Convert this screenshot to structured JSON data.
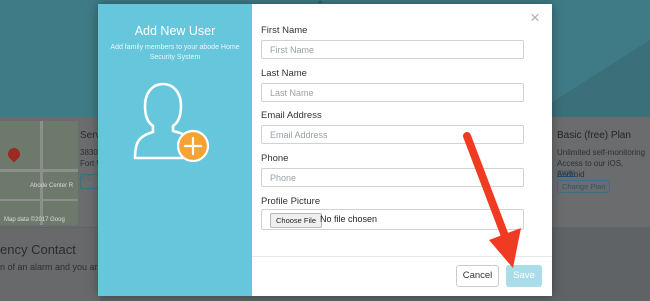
{
  "background": {
    "service_title": "Serv",
    "service_lines": [
      "3830",
      "Fort W"
    ],
    "service_pill": "+ C",
    "map_labels": [
      "Abode Center R",
      "Map data ©2017 Goog"
    ],
    "plan_title": "Basic (free) Plan",
    "plan_text": "Unlimited self-monitoring Access to our iOS, Android",
    "plan_more": "more",
    "plan_button": "Change Plan",
    "emergency_title": "ency Contact",
    "emergency_text": "n of an alarm and you are p"
  },
  "modal": {
    "title": "Add New User",
    "subtitle": "Add family members to your abode Home Security System",
    "close": "×",
    "fields": [
      {
        "label": "First Name",
        "placeholder": "First Name",
        "value": ""
      },
      {
        "label": "Last Name",
        "placeholder": "Last Name",
        "value": ""
      },
      {
        "label": "Email Address",
        "placeholder": "Email Address",
        "value": ""
      },
      {
        "label": "Phone",
        "placeholder": "Phone",
        "value": ""
      }
    ],
    "picture": {
      "label": "Profile Picture",
      "button": "Choose File",
      "status": "No file chosen"
    },
    "cancel_label": "Cancel",
    "save_label": "Save"
  },
  "colors": {
    "accent": "#65c6dc",
    "save_disabled": "#a8dde9",
    "arrow": "#f03a22",
    "plus_badge": "#f7a234"
  },
  "icons": [
    "user-silhouette-icon",
    "plus-icon",
    "close-icon",
    "map-pin-icon"
  ]
}
